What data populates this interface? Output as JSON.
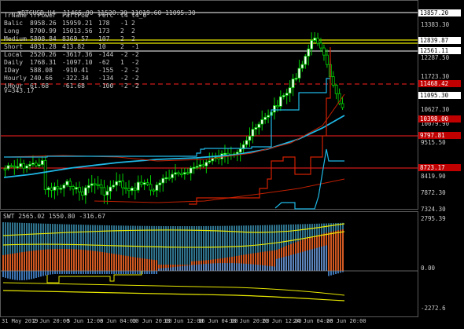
{
  "header": {
    "symbol_line": "BTCUSD,H4  11465.80 11520.30 11019.60 11095.30",
    "table_header": [
      "TrName",
      "TrPower",
      "PartPow",
      "Perc",
      "t4",
      "t4_0"
    ],
    "table_rows": [
      [
        "Balic",
        "8958.26",
        "15959.21",
        "178",
        "-1",
        "2"
      ],
      [
        "Long",
        "8700.99",
        "15013.56",
        "173",
        "2",
        "2"
      ],
      [
        "Medium",
        "5808.84",
        "8369.57",
        "107",
        "2",
        "2"
      ],
      [
        "Short",
        "4031.28",
        "413.82",
        "10",
        "2",
        "-1"
      ],
      [
        "Local",
        "2520.26",
        "-3617.36",
        "-144",
        "-2",
        "-2"
      ],
      [
        "Daily",
        "1768.31",
        "-1097.10",
        "-62",
        "1",
        "-2"
      ],
      [
        "IDay",
        "588.08",
        "-910.41",
        "-155",
        "-2",
        "-2"
      ],
      [
        "Hourly",
        "240.66",
        "-322.34",
        "-134",
        "-2",
        "-2"
      ],
      [
        "iHour",
        "61.68",
        "-61.68",
        "-100",
        "-2",
        "-2"
      ]
    ],
    "v_line": "V=343.17"
  },
  "price_axis": {
    "labels": [
      "13383.30",
      "12287.50",
      "11723.30",
      "10627.30",
      "10079.90",
      "9515.50",
      "8419.90",
      "7872.30",
      "7324.30"
    ],
    "tags": [
      {
        "text": "13857.20",
        "bg": "#ffffff",
        "fg": "#000000"
      },
      {
        "text": "12839.87",
        "bg": "#ffffff",
        "fg": "#000000"
      },
      {
        "text": "12561.11",
        "bg": "#ffffff",
        "fg": "#000000"
      },
      {
        "text": "11468.42",
        "bg": "#c00000",
        "fg": "#ffffff"
      },
      {
        "text": "11095.30",
        "bg": "#ffffff",
        "fg": "#000000"
      },
      {
        "text": "10398.00",
        "bg": "#c00000",
        "fg": "#ffffff"
      },
      {
        "text": "9797.81",
        "bg": "#c00000",
        "fg": "#ffffff"
      },
      {
        "text": "8723.17",
        "bg": "#c00000",
        "fg": "#ffffff"
      }
    ]
  },
  "indicator": {
    "title": "SWT 2565.02 1550.80 -316.67",
    "axis_labels": [
      "2795.39",
      "0.00",
      "-2272.6"
    ]
  },
  "time_axis": [
    "31 May 2019",
    "2 Jun 20:00",
    "5 Jun 12:00",
    "8 Jun 04:00",
    "10 Jun 20:00",
    "13 Jun 12:00",
    "16 Jun 04:00",
    "18 Jun 20:00",
    "21 Jun 12:00",
    "24 Jun 04:00",
    "26 Jun 20:00"
  ],
  "colors": {
    "candle": "#00d000",
    "ma_fast": "#00bfff",
    "channel": "#ff3000",
    "level_yellow": "#e8e800",
    "grid_white": "#ffffff"
  }
}
